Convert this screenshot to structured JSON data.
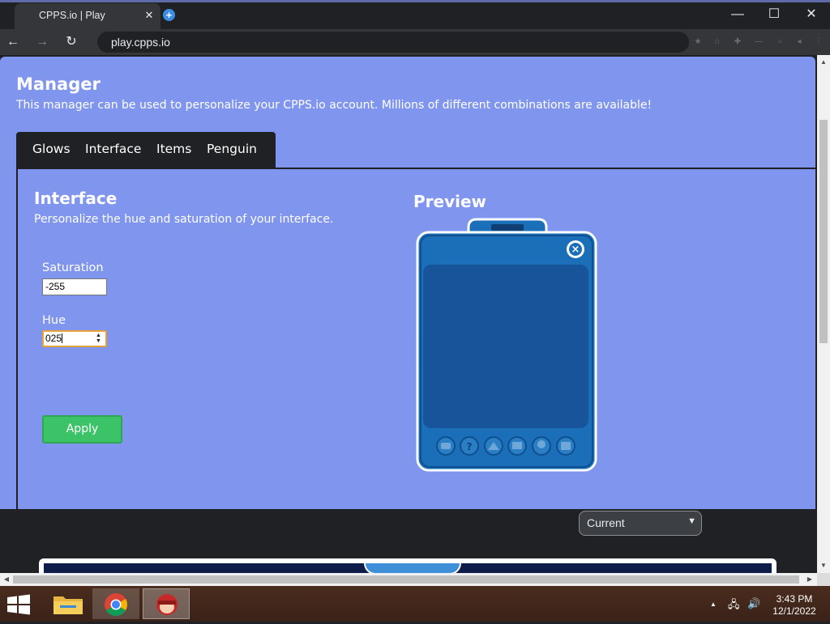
{
  "browser": {
    "tab_title": "CPPS.io | Play",
    "tab_close": "✕",
    "new_tab": "+",
    "url": "play.cpps.io",
    "window_controls": {
      "minimize": "—",
      "maximize": "☐",
      "close": "✕"
    },
    "nav": {
      "back": "←",
      "forward": "→",
      "reload": "↻"
    }
  },
  "manager": {
    "title": "Manager",
    "subtitle": "This manager can be used to personalize your CPPS.io account. Millions of different combinations are available!",
    "tabs": [
      {
        "label": "Glows"
      },
      {
        "label": "Interface"
      },
      {
        "label": "Items"
      },
      {
        "label": "Penguin"
      }
    ]
  },
  "interface_section": {
    "title": "Interface",
    "subtitle": "Personalize the hue and saturation of your interface.",
    "saturation_label": "Saturation",
    "saturation_value": "-255",
    "hue_label": "Hue",
    "hue_value": "025",
    "apply_label": "Apply"
  },
  "preview": {
    "title": "Preview",
    "close_glyph": "×",
    "bottom_icons": [
      "smile-icon",
      "help-icon",
      "igloo-icon",
      "mail-icon",
      "globe-icon",
      "stamp-icon"
    ],
    "colors": {
      "frame": "#1a6fb8",
      "inner": "#17549a",
      "outline": "#ffffff"
    }
  },
  "lower_bar": {
    "select_value": "Current"
  },
  "taskbar": {
    "time": "3:43 PM",
    "date": "12/1/2022",
    "tray_up": "▲"
  },
  "colors": {
    "page_bg": "#8096ee",
    "dark": "#202124",
    "apply_green": "#3cc368"
  }
}
